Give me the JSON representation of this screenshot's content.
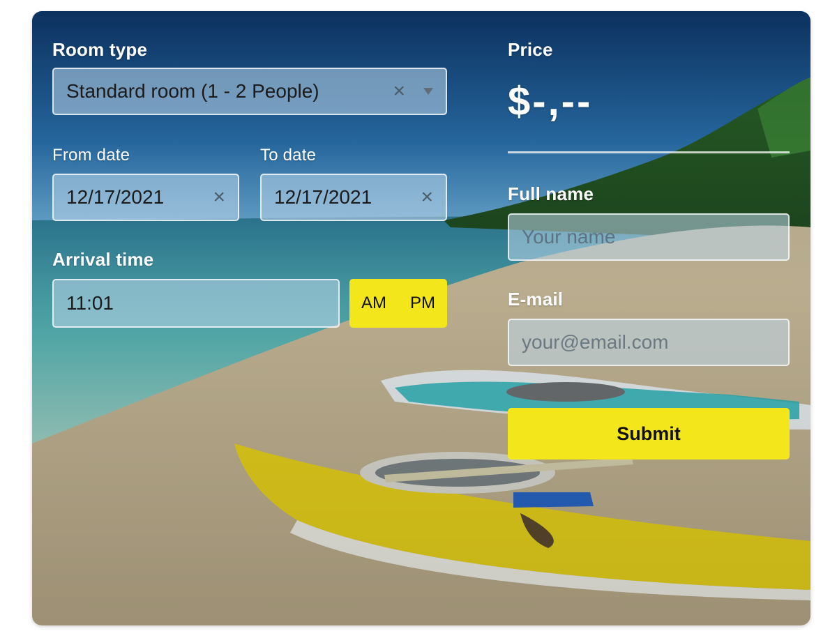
{
  "form": {
    "room_type": {
      "label": "Room type",
      "selected": "Standard room (1 - 2 People)",
      "clear_glyph": "×"
    },
    "from_date": {
      "label": "From date",
      "value": "12/17/2021",
      "clear_glyph": "×"
    },
    "to_date": {
      "label": "To date",
      "value": "12/17/2021",
      "clear_glyph": "×"
    },
    "arrival_time": {
      "label": "Arrival time",
      "value": "11:01",
      "am_label": "AM",
      "pm_label": "PM"
    },
    "price": {
      "label": "Price",
      "value": "$-,--"
    },
    "full_name": {
      "label": "Full name",
      "placeholder": "Your name"
    },
    "email": {
      "label": "E-mail",
      "placeholder": "your@email.com"
    },
    "submit_label": "Submit"
  },
  "colors": {
    "accent_yellow": "#f3e71b",
    "label_text": "#ffffff",
    "field_text": "#1b1b1b"
  },
  "background": {
    "description_icon": "beach-kayak-photo"
  }
}
